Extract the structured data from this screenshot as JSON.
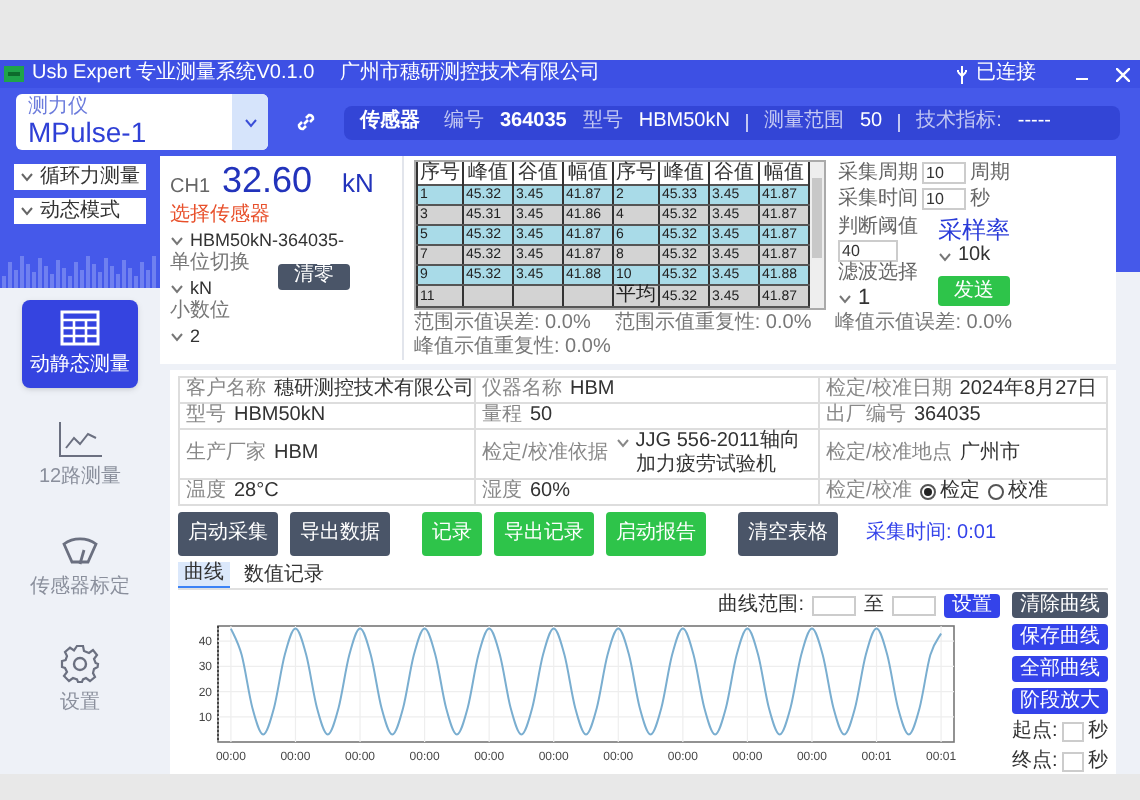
{
  "title_bar": {
    "app_title": "Usb Expert 专业测量系统V0.1.0",
    "company": "广州市穗研测控技术有限公司",
    "connection": "已连接"
  },
  "device_select": {
    "label": "测力仪",
    "value": "MPulse-1"
  },
  "sensor_bar": {
    "tag": "传感器",
    "fields": [
      {
        "label": "编号",
        "value": "364035"
      },
      {
        "label": "型号",
        "value": "HBM50kN"
      },
      {
        "label": "测量范围",
        "value": "50"
      },
      {
        "label": "技术指标:",
        "value": "-----"
      }
    ]
  },
  "mode_dropdowns": [
    "循环力测量",
    "动态模式"
  ],
  "nav": [
    {
      "label": "动静态测量",
      "selected": true
    },
    {
      "label": "12路测量",
      "selected": false
    },
    {
      "label": "传感器标定",
      "selected": false
    },
    {
      "label": "设置",
      "selected": false
    }
  ],
  "reading": {
    "channel": "CH1",
    "value": "32.60",
    "unit": "kN"
  },
  "sensor_settings": [
    {
      "label": "选择传感器",
      "highlighted": true,
      "value": "HBM50kN-364035-"
    },
    {
      "label": "单位切换",
      "highlighted": false,
      "value": "kN"
    },
    {
      "label": "小数位",
      "highlighted": false,
      "value": "2"
    }
  ],
  "zero_button": "清零",
  "table": {
    "columns": [
      "序号",
      "峰值",
      "谷值",
      "幅值",
      "序号",
      "峰值",
      "谷值",
      "幅值"
    ],
    "rows": [
      [
        "1",
        "45.32",
        "3.45",
        "41.87",
        "2",
        "45.33",
        "3.45",
        "41.87"
      ],
      [
        "3",
        "45.31",
        "3.45",
        "41.86",
        "4",
        "45.32",
        "3.45",
        "41.87"
      ],
      [
        "5",
        "45.32",
        "3.45",
        "41.87",
        "6",
        "45.32",
        "3.45",
        "41.87"
      ],
      [
        "7",
        "45.32",
        "3.45",
        "41.87",
        "8",
        "45.32",
        "3.45",
        "41.87"
      ],
      [
        "9",
        "45.32",
        "3.45",
        "41.88",
        "10",
        "45.32",
        "3.45",
        "41.88"
      ],
      [
        "11",
        null,
        null,
        null,
        "平均",
        "45.32",
        "3.45",
        "41.87"
      ]
    ]
  },
  "stats": [
    {
      "label": "范围示值误差:",
      "value": "0.0%"
    },
    {
      "label": "范围示值重复性:",
      "value": "0.0%"
    },
    {
      "label": "峰值示值误差:",
      "value": "0.0%"
    },
    {
      "label": "峰值示值重复性:",
      "value": "0.0%"
    }
  ],
  "acquisition": {
    "inputs": [
      {
        "label": "采集周期",
        "value": "10",
        "unit": "周期"
      },
      {
        "label": "采集时间",
        "value": "10",
        "unit": "秒"
      }
    ],
    "threshold": {
      "label": "判断阈值",
      "value": "40"
    },
    "filter": {
      "label": "滤波选择",
      "value": "1"
    },
    "sample_rate": {
      "label": "采样率",
      "value": "10k"
    },
    "send_button": "发送"
  },
  "form": [
    [
      {
        "kind": "text",
        "label": "客户名称",
        "value": "穗研测控技术有限公司"
      },
      {
        "kind": "text",
        "label": "仪器名称",
        "value": "HBM"
      },
      {
        "kind": "text",
        "label": "检定/校准日期",
        "value": "2024年8月27日"
      }
    ],
    [
      {
        "kind": "text",
        "label": "型号",
        "value": "HBM50kN"
      },
      {
        "kind": "text",
        "label": "量程",
        "value": "50"
      },
      {
        "kind": "text",
        "label": "出厂编号",
        "value": "364035"
      }
    ],
    [
      {
        "kind": "text",
        "label": "生产厂家",
        "value": "HBM"
      },
      {
        "kind": "dropdown",
        "label": "检定/校准依据",
        "value": "JJG 556-2011轴向加力疲劳试验机"
      },
      {
        "kind": "text",
        "label": "检定/校准地点",
        "value": "广州市"
      }
    ],
    [
      {
        "kind": "text",
        "label": "温度",
        "value": "28°C"
      },
      {
        "kind": "text",
        "label": "湿度",
        "value": "60%"
      },
      {
        "kind": "radio",
        "label": "检定/校准",
        "options": [
          {
            "label": "检定",
            "selected": true
          },
          {
            "label": "校准",
            "selected": false
          }
        ]
      }
    ]
  ],
  "actions": [
    {
      "label": "启动采集",
      "kind": "dark"
    },
    {
      "label": "导出数据",
      "kind": "dark"
    },
    {
      "label": "记录",
      "kind": "green"
    },
    {
      "label": "导出记录",
      "kind": "green"
    },
    {
      "label": "启动报告",
      "kind": "green"
    },
    {
      "label": "清空表格",
      "kind": "dark"
    }
  ],
  "elapsed": "采集时间: 0:01",
  "tabs": [
    {
      "label": "曲线",
      "selected": true
    },
    {
      "label": "数值记录",
      "selected": false
    }
  ],
  "curve_range": {
    "label": "曲线范围:",
    "to": "至",
    "button": "设置"
  },
  "curve_buttons": [
    {
      "label": "清除曲线",
      "kind": "dark"
    },
    {
      "label": "保存曲线",
      "kind": "blue"
    },
    {
      "label": "全部曲线",
      "kind": "blue"
    },
    {
      "label": "阶段放大",
      "kind": "blue"
    }
  ],
  "zoom_range": [
    {
      "label": "起点:",
      "unit": "秒"
    },
    {
      "label": "终点:",
      "unit": "秒"
    }
  ],
  "chart_data": {
    "type": "line",
    "grid": true,
    "xlim": [
      -0.02,
      1.12
    ],
    "ylim": [
      0,
      46
    ],
    "yticks": [
      10,
      20,
      30,
      40
    ],
    "x": [
      0,
      0.0167,
      0.0333,
      0.05,
      0.0667,
      0.0833,
      0.1,
      0.1167,
      0.1333,
      0.15,
      0.1667,
      0.1833,
      0.2,
      0.2167,
      0.2333,
      0.25,
      0.2667,
      0.2833,
      0.3,
      0.3167,
      0.3333,
      0.35,
      0.3667,
      0.3833,
      0.4,
      0.4167,
      0.4333,
      0.45,
      0.4667,
      0.4833,
      0.5,
      0.5167,
      0.5333,
      0.55,
      0.5667,
      0.5833,
      0.6,
      0.6167,
      0.6333,
      0.65,
      0.6667,
      0.6833,
      0.7,
      0.7167,
      0.7333,
      0.75,
      0.7667,
      0.7833,
      0.8,
      0.8167,
      0.8333,
      0.85,
      0.8667,
      0.8833,
      0.9,
      0.9167,
      0.9333,
      0.95,
      0.9667,
      0.9833,
      1,
      1.0167,
      1.0333,
      1.05,
      1.0667,
      1.0833,
      1.1
    ],
    "xticks": [
      {
        "value": 0,
        "label": "00:00"
      },
      {
        "value": 0.1,
        "label": "00:00"
      },
      {
        "value": 0.2,
        "label": "00:00"
      },
      {
        "value": 0.3,
        "label": "00:00"
      },
      {
        "value": 0.4,
        "label": "00:00"
      },
      {
        "value": 0.5,
        "label": "00:00"
      },
      {
        "value": 0.6,
        "label": "00:00"
      },
      {
        "value": 0.7,
        "label": "00:00"
      },
      {
        "value": 0.8,
        "label": "00:00"
      },
      {
        "value": 0.9,
        "label": "00:00"
      },
      {
        "value": 1.0,
        "label": "00:01"
      },
      {
        "value": 1.1,
        "label": "00:01"
      }
    ],
    "series": [
      {
        "color": "#7aaed0",
        "values": [
          45,
          34.5,
          13.5,
          3,
          13.5,
          34.5,
          45,
          34.5,
          13.5,
          3,
          13.5,
          34.5,
          45,
          34.5,
          13.5,
          3,
          13.5,
          34.5,
          45,
          34.5,
          13.5,
          3,
          13.5,
          34.5,
          45,
          34.5,
          13.5,
          3,
          13.5,
          34.5,
          45,
          34.5,
          13.5,
          3,
          13.5,
          34.5,
          45,
          34.5,
          13.5,
          3,
          13.5,
          34.5,
          45,
          34.5,
          13.5,
          3,
          13.5,
          34.5,
          45,
          34.5,
          13.5,
          3,
          13.5,
          34.5,
          45,
          34.5,
          13.5,
          3,
          13.5,
          34.5,
          45,
          34.5,
          13.5,
          3,
          13.5,
          34.5,
          43
        ]
      }
    ]
  }
}
